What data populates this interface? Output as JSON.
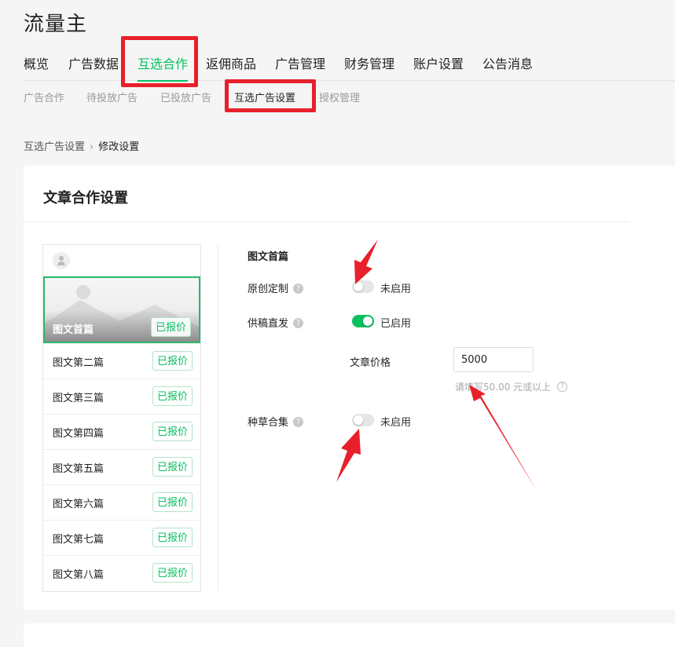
{
  "app": {
    "title": "流量主"
  },
  "main_nav": {
    "tabs": [
      {
        "label": "概览"
      },
      {
        "label": "广告数据"
      },
      {
        "label": "互选合作"
      },
      {
        "label": "返佣商品"
      },
      {
        "label": "广告管理"
      },
      {
        "label": "财务管理"
      },
      {
        "label": "账户设置"
      },
      {
        "label": "公告消息"
      }
    ],
    "active_index": 2
  },
  "sub_nav": {
    "tabs": [
      {
        "label": "广告合作"
      },
      {
        "label": "待投放广告"
      },
      {
        "label": "已投放广告"
      },
      {
        "label": "互选广告设置"
      },
      {
        "label": "授权管理"
      }
    ],
    "active_index": 3
  },
  "breadcrumb": {
    "parent": "互选广告设置",
    "current": "修改设置"
  },
  "card": {
    "title": "文章合作设置"
  },
  "article_list": {
    "price_label": "已报价",
    "items": [
      {
        "label": "图文首篇"
      },
      {
        "label": "图文第二篇"
      },
      {
        "label": "图文第三篇"
      },
      {
        "label": "图文第四篇"
      },
      {
        "label": "图文第五篇"
      },
      {
        "label": "图文第六篇"
      },
      {
        "label": "图文第七篇"
      },
      {
        "label": "图文第八篇"
      }
    ],
    "selected_index": 0
  },
  "settings": {
    "section_title": "图文首篇",
    "original": {
      "label": "原创定制",
      "enabled": false,
      "status_text": "未启用"
    },
    "direct": {
      "label": "供稿直发",
      "enabled": true,
      "status_text": "已启用"
    },
    "price": {
      "label": "文章价格",
      "value": "5000",
      "hint": "请填写50.00 元或以上"
    },
    "grass": {
      "label": "种草合集",
      "enabled": false,
      "status_text": "未启用"
    }
  },
  "icons": {
    "help": "question-circle-icon",
    "breadcrumb_sep": "chevron-right-icon",
    "avatar": "user-avatar-icon"
  },
  "colors": {
    "accent": "#07c160",
    "annotation": "#e8202a"
  }
}
